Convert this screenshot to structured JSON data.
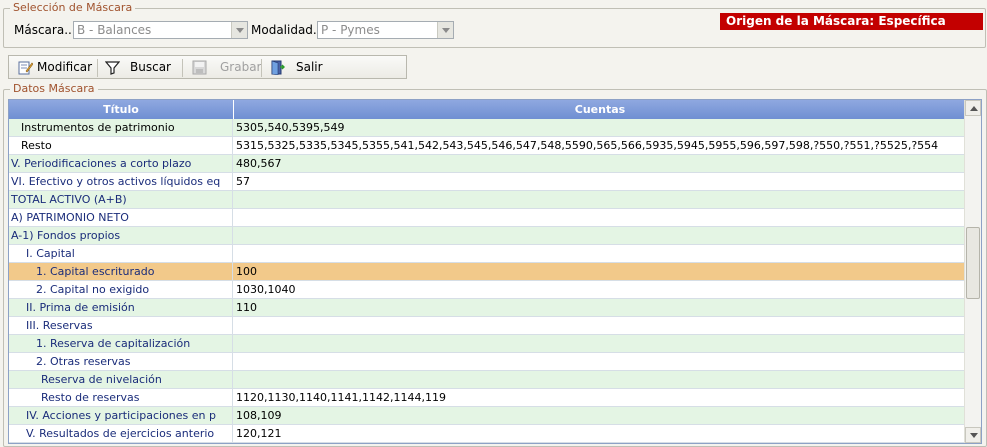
{
  "seleccion": {
    "legend": "Selección de Máscara",
    "mascara_label": "Máscara..",
    "mascara_value": "B - Balances",
    "modalidad_label": "Modalidad..",
    "modalidad_value": "P - Pymes",
    "origen_text": "Origen de la Máscara: Específica"
  },
  "toolbar": {
    "modificar": "Modificar",
    "buscar": "Buscar",
    "grabar": "Grabar",
    "salir": "Salir"
  },
  "datos": {
    "legend": "Datos Máscara",
    "columns": [
      "Título",
      "Cuentas"
    ],
    "rows": [
      {
        "titulo": "Instrumentos de patrimonio",
        "cuentas": "5305,540,5395,549",
        "indent": 2,
        "color": "dark",
        "style": "alt"
      },
      {
        "titulo": "Resto",
        "cuentas": "5315,5325,5335,5345,5355,541,542,543,545,546,547,548,5590,565,566,5935,5945,5955,596,597,598,?550,?551,?5525,?554",
        "indent": 2,
        "color": "dark",
        "style": ""
      },
      {
        "titulo": "V. Periodificaciones a corto plazo",
        "cuentas": "480,567",
        "indent": 0,
        "color": "blue",
        "style": "alt"
      },
      {
        "titulo": "VI. Efectivo y otros activos líquidos eq",
        "cuentas": "57",
        "indent": 0,
        "color": "blue",
        "style": ""
      },
      {
        "titulo": "TOTAL ACTIVO (A+B)",
        "cuentas": "",
        "indent": 0,
        "color": "blue",
        "style": "alt"
      },
      {
        "titulo": "A) PATRIMONIO NETO",
        "cuentas": "",
        "indent": 0,
        "color": "blue",
        "style": ""
      },
      {
        "titulo": "A-1) Fondos propios",
        "cuentas": "",
        "indent": 0,
        "color": "blue",
        "style": "alt"
      },
      {
        "titulo": "I. Capital",
        "cuentas": "",
        "indent": 3,
        "color": "blue",
        "style": ""
      },
      {
        "titulo": "1. Capital escriturado",
        "cuentas": "100",
        "indent": 5,
        "color": "blue",
        "style": "sel"
      },
      {
        "titulo": "2. Capital no exigido",
        "cuentas": "1030,1040",
        "indent": 5,
        "color": "blue",
        "style": ""
      },
      {
        "titulo": "II. Prima de emisión",
        "cuentas": "110",
        "indent": 3,
        "color": "blue",
        "style": "alt"
      },
      {
        "titulo": "III. Reservas",
        "cuentas": "",
        "indent": 3,
        "color": "blue",
        "style": ""
      },
      {
        "titulo": "1. Reserva de capitalización",
        "cuentas": "",
        "indent": 5,
        "color": "blue",
        "style": "alt"
      },
      {
        "titulo": "2. Otras reservas",
        "cuentas": "",
        "indent": 5,
        "color": "blue",
        "style": ""
      },
      {
        "titulo": "Reserva de nivelación",
        "cuentas": "",
        "indent": 6,
        "color": "blue",
        "style": "alt"
      },
      {
        "titulo": "Resto de reservas",
        "cuentas": "1120,1130,1140,1141,1142,1144,119",
        "indent": 6,
        "color": "blue",
        "style": ""
      },
      {
        "titulo": "IV. Acciones y participaciones en p",
        "cuentas": "108,109",
        "indent": 3,
        "color": "blue",
        "style": "alt"
      },
      {
        "titulo": "V. Resultados de ejercicios anterio",
        "cuentas": "120,121",
        "indent": 3,
        "color": "blue",
        "style": ""
      }
    ]
  }
}
